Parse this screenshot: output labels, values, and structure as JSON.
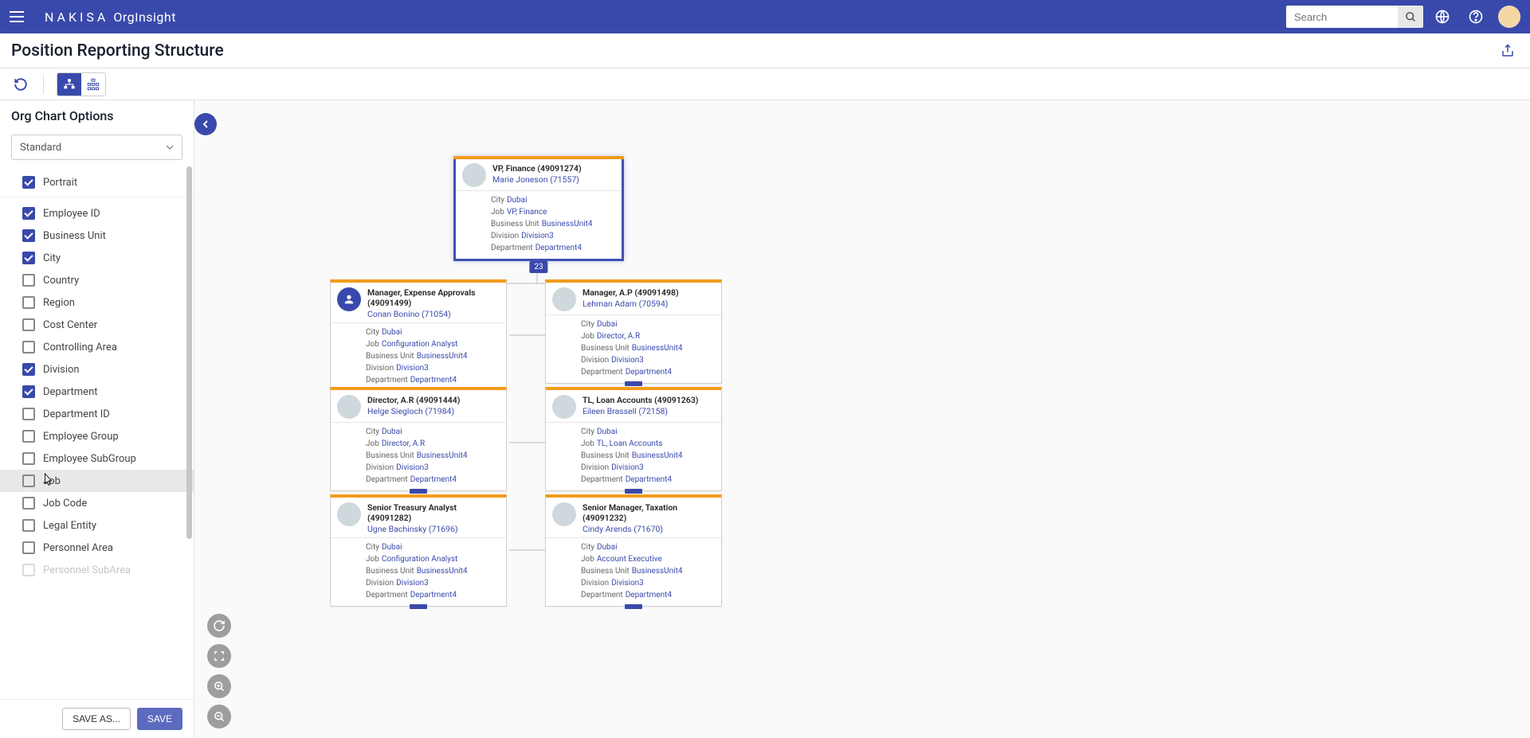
{
  "header": {
    "brand": "NAKISA",
    "product": "OrgInsight",
    "search_placeholder": "Search"
  },
  "page": {
    "title": "Position Reporting Structure"
  },
  "sidebar": {
    "title": "Org Chart Options",
    "select_value": "Standard",
    "options": [
      {
        "label": "Portrait",
        "checked": true,
        "section_break": true
      },
      {
        "label": "Employee ID",
        "checked": true
      },
      {
        "label": "Business Unit",
        "checked": true
      },
      {
        "label": "City",
        "checked": true
      },
      {
        "label": "Country",
        "checked": false
      },
      {
        "label": "Region",
        "checked": false
      },
      {
        "label": "Cost Center",
        "checked": false
      },
      {
        "label": "Controlling Area",
        "checked": false
      },
      {
        "label": "Division",
        "checked": true
      },
      {
        "label": "Department",
        "checked": true
      },
      {
        "label": "Department ID",
        "checked": false
      },
      {
        "label": "Employee Group",
        "checked": false
      },
      {
        "label": "Employee SubGroup",
        "checked": false
      },
      {
        "label": "Job",
        "checked": false,
        "highlighted": true
      },
      {
        "label": "Job Code",
        "checked": false
      },
      {
        "label": "Legal Entity",
        "checked": false
      },
      {
        "label": "Personnel Area",
        "checked": false
      },
      {
        "label": "Personnel SubArea",
        "checked": false,
        "cut": true
      }
    ],
    "save_as": "SAVE AS...",
    "save": "SAVE"
  },
  "org": {
    "root": {
      "position": "VP, Finance (49091274)",
      "employee": "Marie Joneson (71557)",
      "city": "Dubai",
      "job": "VP, Finance",
      "bu": "BusinessUnit4",
      "division": "Division3",
      "department": "Department4",
      "badge": "23"
    },
    "children": [
      {
        "position": "Manager, Expense Approvals (49091499)",
        "employee": "Conan Bonino (71054)",
        "city": "Dubai",
        "job": "Configuration Analyst",
        "bu": "BusinessUnit4",
        "division": "Division3",
        "department": "Department4",
        "placeholder": true
      },
      {
        "position": "Manager, A.P (49091498)",
        "employee": "Lehman Adam (70594)",
        "city": "Dubai",
        "job": "Director, A.R",
        "bu": "BusinessUnit4",
        "division": "Division3",
        "department": "Department4"
      },
      {
        "position": "Director, A.R (49091444)",
        "employee": "Helge Siegloch (71984)",
        "city": "Dubai",
        "job": "Director, A.R",
        "bu": "BusinessUnit4",
        "division": "Division3",
        "department": "Department4"
      },
      {
        "position": "TL, Loan Accounts (49091263)",
        "employee": "Eileen Brassell (72158)",
        "city": "Dubai",
        "job": "TL, Loan Accounts",
        "bu": "BusinessUnit4",
        "division": "Division3",
        "department": "Department4"
      },
      {
        "position": "Senior Treasury Analyst (49091282)",
        "employee": "Ugne Bachinsky (71696)",
        "city": "Dubai",
        "job": "Configuration Analyst",
        "bu": "BusinessUnit4",
        "division": "Division3",
        "department": "Department4"
      },
      {
        "position": "Senior Manager, Taxation (49091232)",
        "employee": "Cindy Arends (71670)",
        "city": "Dubai",
        "job": "Account Executive",
        "bu": "BusinessUnit4",
        "division": "Division3",
        "department": "Department4"
      }
    ],
    "labels": {
      "city": "City",
      "job": "Job",
      "bu": "Business Unit",
      "division": "Division",
      "department": "Department"
    }
  }
}
